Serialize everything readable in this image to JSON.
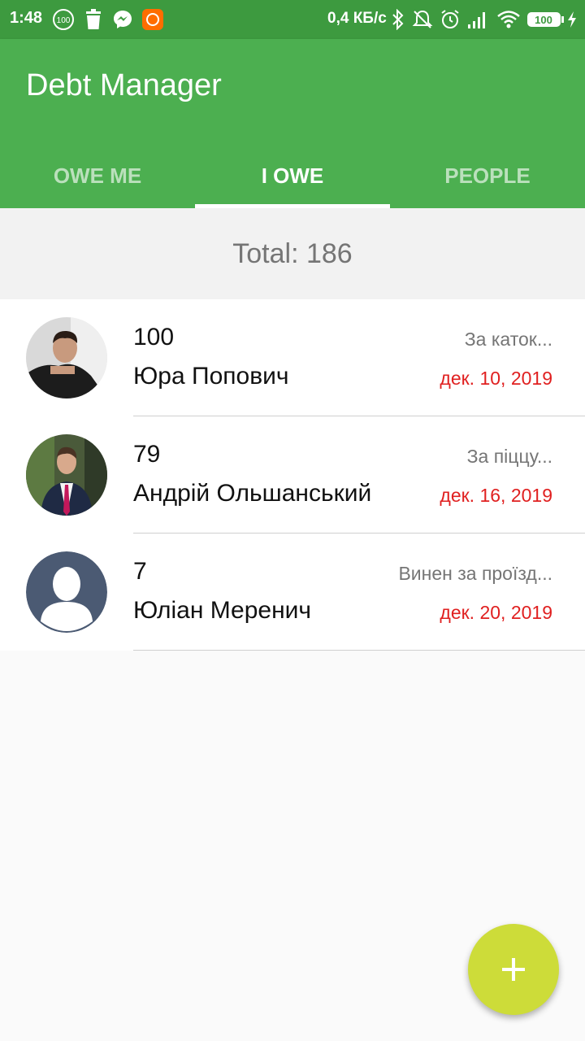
{
  "status_bar": {
    "time": "1:48",
    "speed": "0,4 КБ/с",
    "battery": "100",
    "notification_badge": "100"
  },
  "app": {
    "title": "Debt Manager",
    "accent": "#4caf50",
    "fab_color": "#cddc39"
  },
  "tabs": [
    {
      "label": "OWE ME",
      "active": false
    },
    {
      "label": "I OWE",
      "active": true
    },
    {
      "label": "PEOPLE",
      "active": false
    }
  ],
  "total": {
    "label": "Total: 186"
  },
  "debts": [
    {
      "amount": "100",
      "name": "Юра Попович",
      "note": "За каток...",
      "date": "дек. 10, 2019"
    },
    {
      "amount": "79",
      "name": "Андрій Ольшанський",
      "note": "За піццу...",
      "date": "дек. 16, 2019"
    },
    {
      "amount": "7",
      "name": "Юліан Меренич",
      "note": "Винен за проїзд...",
      "date": "дек. 20, 2019"
    }
  ],
  "fab": {
    "icon": "plus-icon",
    "label": "+"
  }
}
